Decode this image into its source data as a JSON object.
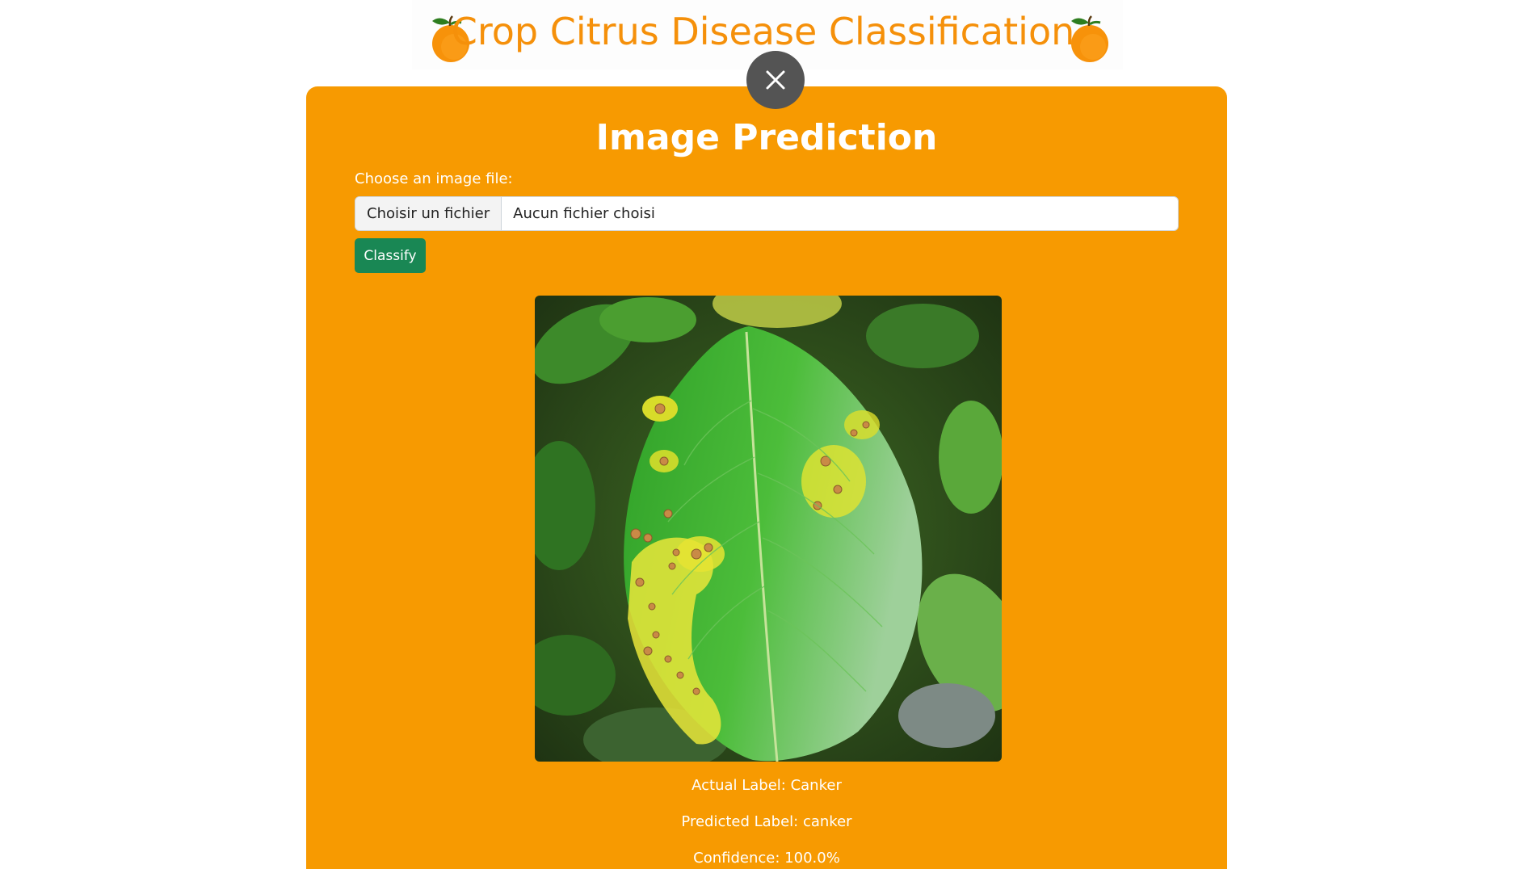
{
  "header": {
    "title": "Crop Citrus Disease Classification",
    "icon_left": "orange-fruit-icon",
    "icon_right": "orange-fruit-icon",
    "title_color": "#f5900a"
  },
  "card": {
    "background": "#f79a01",
    "close_icon": "close-icon",
    "title": "Image Prediction",
    "file_label": "Choose an image file:",
    "file_button_label": "Choisir un fichier",
    "file_name_text": "Aucun fichier choisi",
    "classify_label": "Classify",
    "classify_color": "#198754",
    "image_subject": "citrus-leaf-photo"
  },
  "results": {
    "actual": "Actual Label: Canker",
    "predicted": "Predicted Label: canker",
    "confidence": "Confidence: 100.0%"
  }
}
